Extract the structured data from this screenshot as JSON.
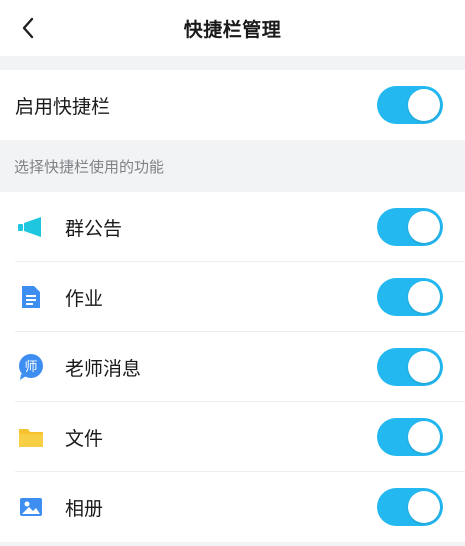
{
  "header": {
    "title": "快捷栏管理",
    "back_icon": "chevron-left-icon"
  },
  "enable": {
    "label": "启用快捷栏",
    "on": true
  },
  "section_title": "选择快捷栏使用的功能",
  "features": [
    {
      "label": "群公告",
      "icon": "megaphone-icon",
      "on": true
    },
    {
      "label": "作业",
      "icon": "document-icon",
      "on": true
    },
    {
      "label": "老师消息",
      "icon": "teacher-message-icon",
      "icon_text": "师",
      "on": true
    },
    {
      "label": "文件",
      "icon": "folder-icon",
      "on": true
    },
    {
      "label": "相册",
      "icon": "photo-album-icon",
      "on": true
    }
  ],
  "colors": {
    "accent": "#24b8f0",
    "background": "#f2f3f5",
    "megaphone": "#1ec6df",
    "document": "#3d8ef0",
    "folder": "#f6c230"
  }
}
